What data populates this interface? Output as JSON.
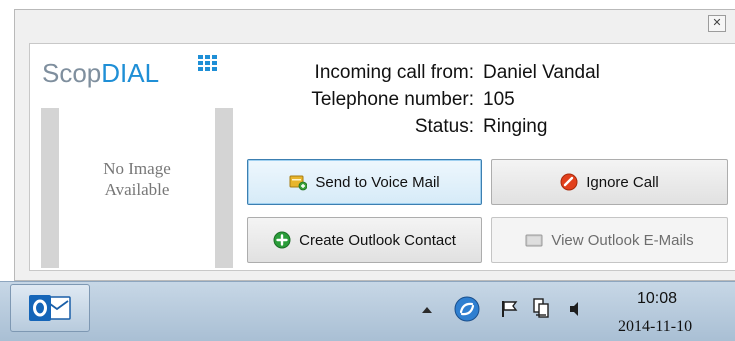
{
  "window": {
    "close_glyph": "✕"
  },
  "logo": {
    "scop": "Scop",
    "dial": "DIAL"
  },
  "avatar": {
    "placeholder": "No Image\nAvailable"
  },
  "caller": {
    "from_label": "Incoming call from:",
    "from_value": "Daniel Vandal",
    "number_label": "Telephone number:",
    "number_value": "105",
    "status_label": "Status:",
    "status_value": "Ringing"
  },
  "buttons": {
    "voicemail": "Send to Voice Mail",
    "ignore": "Ignore Call",
    "create_contact": "Create Outlook Contact",
    "view_emails": "View Outlook E-Mails"
  },
  "taskbar": {
    "time": "10:08",
    "date": "2014-11-10",
    "app_icon": "outlook-icon",
    "tray_icons": [
      "show-hidden-icons-arrow",
      "sync-icon",
      "action-center-flag-icon",
      "network-icon",
      "volume-icon"
    ]
  },
  "colors": {
    "brand_blue": "#1f8fd6",
    "logo_grey": "#7f8f9e",
    "ignore_red": "#e2401c",
    "create_green": "#2a9d3a"
  }
}
